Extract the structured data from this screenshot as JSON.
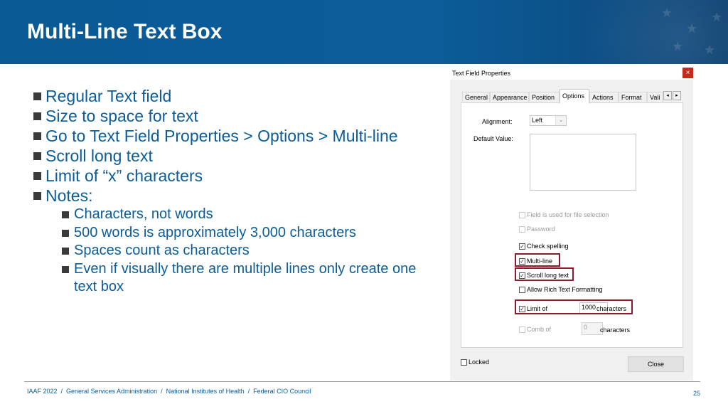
{
  "slide": {
    "title": "Multi-Line Text Box",
    "bullets": [
      "Regular Text field",
      "Size to space for text",
      "Go to Text Field Properties > Options > Multi-line",
      "Scroll long text",
      "Limit of “x” characters",
      "Notes:"
    ],
    "sub_bullets": [
      "Characters, not words",
      "500 words is approximately 3,000 characters",
      "Spaces count as characters",
      "Even if visually there are multiple lines only create one text box"
    ]
  },
  "dialog": {
    "title": "Text Field Properties",
    "close_x": "×",
    "tabs": [
      "General",
      "Appearance",
      "Position",
      "Options",
      "Actions",
      "Format",
      "Vali"
    ],
    "active_tab": "Options",
    "tab_prev": "◂",
    "tab_next": "▸",
    "alignment_label": "Alignment:",
    "alignment_value": "Left",
    "alignment_chevron": "⌄",
    "default_value_label": "Default Value:",
    "checkboxes": {
      "file_selection": {
        "label": "Field is used for file selection",
        "checked": false,
        "enabled": false
      },
      "password": {
        "label": "Password",
        "checked": false,
        "enabled": false
      },
      "check_spelling": {
        "label": "Check spelling",
        "checked": true,
        "enabled": true
      },
      "multi_line": {
        "label": "Multi-line",
        "checked": true,
        "enabled": true
      },
      "scroll_long_text": {
        "label": "Scroll long text",
        "checked": true,
        "enabled": true
      },
      "rich_text": {
        "label": "Allow Rich Text Formatting",
        "checked": false,
        "enabled": true
      },
      "limit_of": {
        "label": "Limit of",
        "checked": true,
        "enabled": true
      },
      "comb_of": {
        "label": "Comb of",
        "checked": false,
        "enabled": false
      }
    },
    "check_glyph": "✓",
    "limit_value": "1000",
    "limit_suffix": "characters",
    "comb_value": "0",
    "comb_suffix": "characters",
    "locked_label": "Locked",
    "close_label": "Close"
  },
  "footer": {
    "text": "IAAF 2022  /  General Services Administration  /  National Institutes of Health  /  Federal CIO Council",
    "page": "25"
  },
  "colors": {
    "banner": "#0b5c98",
    "bullet_text": "#0b5c98",
    "highlight": "#8e1c2d",
    "close_x_bg": "#c42b1c"
  }
}
